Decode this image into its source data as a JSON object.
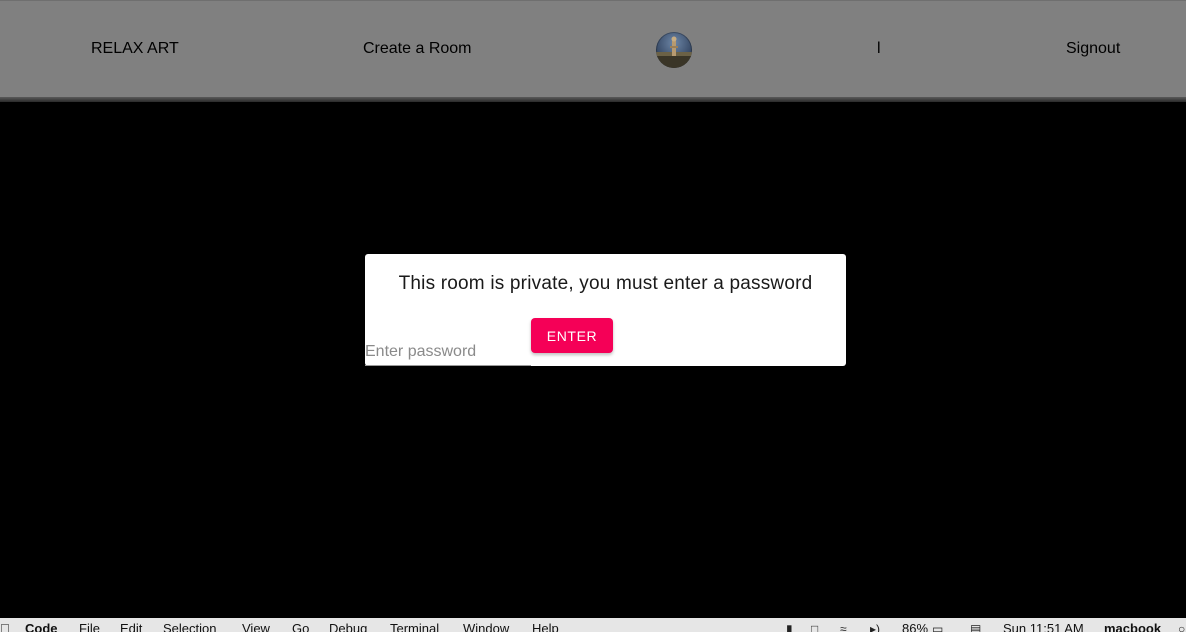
{
  "navbar": {
    "brand": "RELAX ART",
    "create_room": "Create a Room",
    "user_name": "l",
    "signout": "Signout",
    "background_color": "#808080"
  },
  "modal": {
    "title": "This room is private, you must enter a password",
    "password_placeholder": "Enter password",
    "password_value": "",
    "enter_button": "ENTER",
    "accent_color": "#f50057"
  },
  "menubar": {
    "apple_icon": "apple-icon",
    "app_name": "Code",
    "items": [
      "File",
      "Edit",
      "Selection",
      "View",
      "Go",
      "Debug",
      "Terminal",
      "Window",
      "Help"
    ],
    "battery": "86%",
    "clock": "Sun 11:51 AM",
    "user": "macbook",
    "status_icons": [
      "torch-icon",
      "display-icon",
      "wifi-icon",
      "volume-icon",
      "battery-icon",
      "cast-icon",
      "search-icon"
    ]
  }
}
